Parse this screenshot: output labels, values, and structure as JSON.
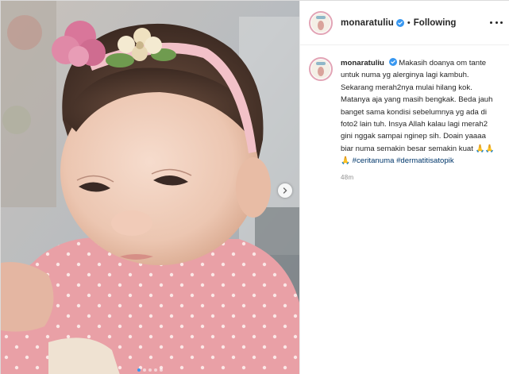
{
  "post": {
    "username": "monaratuliu",
    "follow_state": "Following",
    "separator": "•",
    "caption_text": "Makasih doanya om tante untuk numa yg alerginya lagi kambuh. Sekarang merah2nya mulai hilang kok. Matanya aja yang masih bengkak. Beda jauh banget sama kondisi sebelumnya yg ada di foto2 lain tuh. Insya Allah kalau lagi merah2 gini nggak sampai nginep sih. Doain yaaaa biar numa semakin besar semakin kuat 🙏🙏🙏 ",
    "hashtags": [
      "#ceritanuma",
      "#dermatitisatopik"
    ],
    "time_ago": "48m",
    "carousel_count": 5,
    "carousel_active_index": 0
  },
  "colors": {
    "verified_badge": "#3897f0",
    "hashtag": "#00376b",
    "avatar_ring": "#e2a4b5",
    "secondary_text": "#8e8e8e"
  },
  "icons": {
    "verified": "verified-badge-icon",
    "next": "chevron-right-icon",
    "more": "more-options-icon"
  }
}
